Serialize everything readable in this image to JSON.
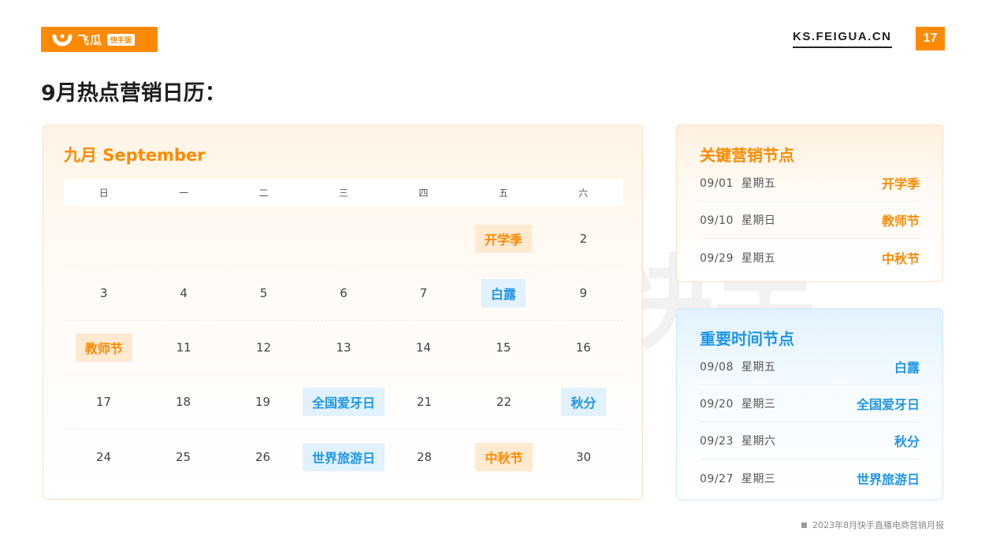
{
  "header": {
    "brand_name": "飞瓜",
    "brand_tag": "快手版",
    "site": "KS.FEIGUA.CN",
    "page_number": "17"
  },
  "page_title": "9月热点营销日历：",
  "watermark": {
    "text": "飞瓜 快手版"
  },
  "calendar": {
    "title": "九月  September",
    "weekdays": [
      "日",
      "一",
      "二",
      "三",
      "四",
      "五",
      "六"
    ],
    "weeks": [
      [
        {
          "text": ""
        },
        {
          "text": ""
        },
        {
          "text": ""
        },
        {
          "text": ""
        },
        {
          "text": ""
        },
        {
          "text": "开学季",
          "type": "key"
        },
        {
          "text": "2"
        }
      ],
      [
        {
          "text": "3"
        },
        {
          "text": "4"
        },
        {
          "text": "5"
        },
        {
          "text": "6"
        },
        {
          "text": "7"
        },
        {
          "text": "白露",
          "type": "imp"
        },
        {
          "text": "9"
        }
      ],
      [
        {
          "text": "教师节",
          "type": "key"
        },
        {
          "text": "11"
        },
        {
          "text": "12"
        },
        {
          "text": "13"
        },
        {
          "text": "14"
        },
        {
          "text": "15"
        },
        {
          "text": "16"
        }
      ],
      [
        {
          "text": "17"
        },
        {
          "text": "18"
        },
        {
          "text": "19"
        },
        {
          "text": "全国爱牙日",
          "type": "imp"
        },
        {
          "text": "21"
        },
        {
          "text": "22"
        },
        {
          "text": "秋分",
          "type": "imp"
        }
      ],
      [
        {
          "text": "24"
        },
        {
          "text": "25"
        },
        {
          "text": "26"
        },
        {
          "text": "世界旅游日",
          "type": "imp"
        },
        {
          "text": "28"
        },
        {
          "text": "中秋节",
          "type": "key"
        },
        {
          "text": "30"
        }
      ]
    ]
  },
  "key_nodes": {
    "title": "关键营销节点",
    "items": [
      {
        "date": "09/01",
        "weekday": "星期五",
        "name": "开学季"
      },
      {
        "date": "09/10",
        "weekday": "星期日",
        "name": "教师节"
      },
      {
        "date": "09/29",
        "weekday": "星期五",
        "name": "中秋节"
      }
    ]
  },
  "important_nodes": {
    "title": "重要时间节点",
    "items": [
      {
        "date": "09/08",
        "weekday": "星期五",
        "name": "白露"
      },
      {
        "date": "09/20",
        "weekday": "星期三",
        "name": "全国爱牙日"
      },
      {
        "date": "09/23",
        "weekday": "星期六",
        "name": "秋分"
      },
      {
        "date": "09/27",
        "weekday": "星期三",
        "name": "世界旅游日"
      }
    ]
  },
  "footer": {
    "text": "2023年8月快手直播电商营销月报"
  },
  "colors": {
    "accent_orange": "#ff8a00",
    "accent_blue": "#2196e8"
  }
}
